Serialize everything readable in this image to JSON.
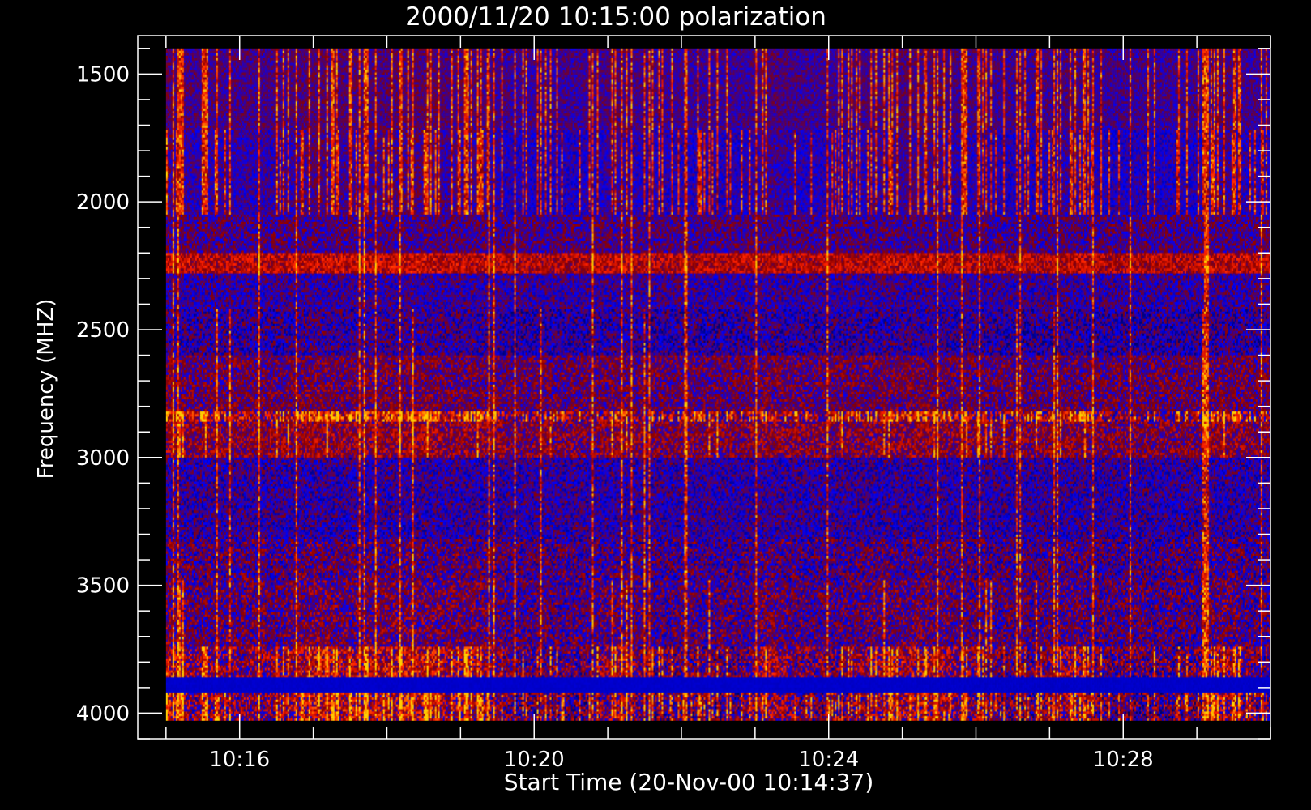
{
  "chart_data": {
    "type": "heatmap",
    "title": "2000/11/20 10:15:00 polarization",
    "xlabel": "Start Time (20-Nov-00 10:14:37)",
    "ylabel": "Frequency (MHZ)",
    "x_range": [
      "10:14:37",
      "10:30:00"
    ],
    "data_x_range": [
      "10:15:00",
      "10:30:00"
    ],
    "ylim": [
      1350,
      4100
    ],
    "y_inverted": true,
    "data_y_range": [
      1400,
      4030
    ],
    "x_ticks": [
      "10:16",
      "10:20",
      "10:24",
      "10:28"
    ],
    "y_ticks": [
      1500,
      2000,
      2500,
      3000,
      3500,
      4000
    ],
    "x_minor_step_minutes": 1,
    "y_minor_step": 100,
    "grid": false,
    "colormap": [
      "#000000",
      "#0000ff",
      "#8b0000",
      "#ff2000",
      "#ffd000"
    ],
    "bands": [
      {
        "from": 1400,
        "to": 1720,
        "base": 0.36,
        "noise": 0.1,
        "stripe": 0.6,
        "warm": 0.1
      },
      {
        "from": 1720,
        "to": 2050,
        "base": 0.3,
        "noise": 0.12,
        "stripe": 0.85,
        "warm": 0.2
      },
      {
        "from": 2050,
        "to": 2200,
        "base": 0.38,
        "noise": 0.16,
        "stripe": 0.1,
        "warm": 0.0
      },
      {
        "from": 2200,
        "to": 2280,
        "base": 0.58,
        "noise": 0.18,
        "stripe": 0.1,
        "warm": 0.1
      },
      {
        "from": 2280,
        "to": 2420,
        "base": 0.34,
        "noise": 0.16,
        "stripe": 0.1,
        "warm": 0.0
      },
      {
        "from": 2420,
        "to": 2600,
        "base": 0.3,
        "noise": 0.2,
        "stripe": 0.15,
        "warm": 0.1
      },
      {
        "from": 2600,
        "to": 2820,
        "base": 0.42,
        "noise": 0.18,
        "stripe": 0.15,
        "warm": 0.05
      },
      {
        "from": 2820,
        "to": 2860,
        "base": 0.45,
        "noise": 0.3,
        "stripe": 1.0,
        "warm": 0.6
      },
      {
        "from": 2860,
        "to": 3000,
        "base": 0.46,
        "noise": 0.2,
        "stripe": 0.25,
        "warm": 0.15
      },
      {
        "from": 3000,
        "to": 3320,
        "base": 0.32,
        "noise": 0.18,
        "stripe": 0.15,
        "warm": 0.0
      },
      {
        "from": 3320,
        "to": 3480,
        "base": 0.36,
        "noise": 0.22,
        "stripe": 0.15,
        "warm": 0.1
      },
      {
        "from": 3480,
        "to": 3740,
        "base": 0.38,
        "noise": 0.22,
        "stripe": 0.2,
        "warm": 0.15
      },
      {
        "from": 3740,
        "to": 3860,
        "base": 0.4,
        "noise": 0.28,
        "stripe": 0.5,
        "warm": 0.5
      },
      {
        "from": 3860,
        "to": 3920,
        "base": 0.2,
        "noise": 0.01,
        "stripe": 0.0,
        "warm": 0.0
      },
      {
        "from": 3920,
        "to": 4030,
        "base": 0.38,
        "noise": 0.3,
        "stripe": 0.9,
        "warm": 0.5
      }
    ]
  }
}
